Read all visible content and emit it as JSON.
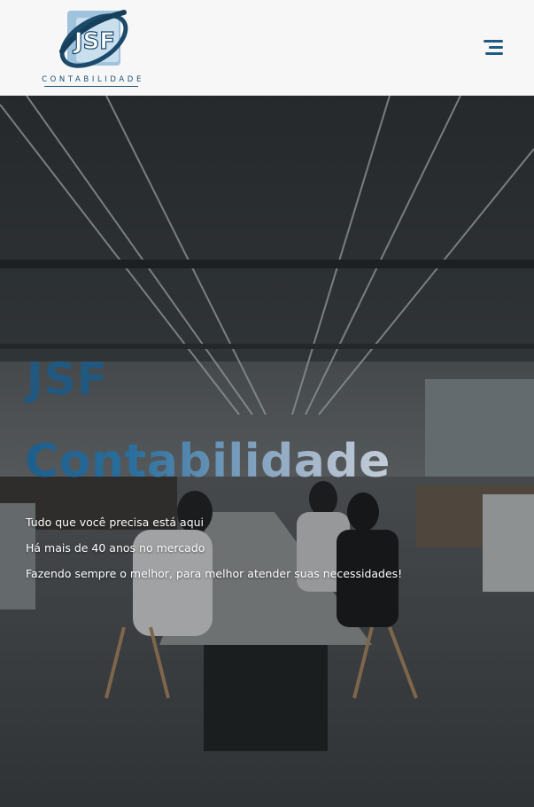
{
  "header": {
    "logo_mark_text": "JSF",
    "logo_wordmark": "CONTABILIDADE",
    "menu_icon": "hamburger-menu-icon"
  },
  "hero": {
    "background": "open-plan-office-photo",
    "title_line_1": "JSF",
    "title_line_2": "Contabilidade",
    "lines": [
      "Tudo que você precisa está aqui",
      "Há mais de 40 anos no mercado",
      "Fazendo sempre o melhor, para melhor atender suas necessidades!"
    ]
  },
  "colors": {
    "brand_blue": "#1e5a86",
    "brand_light_blue": "#8fb3cf",
    "header_bg": "#f7f7f7",
    "hero_text": "#ffffff"
  }
}
